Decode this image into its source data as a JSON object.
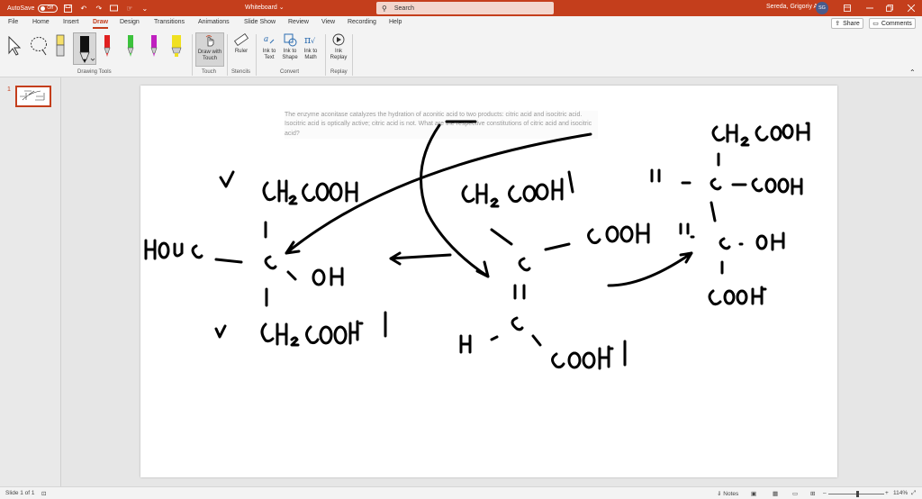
{
  "titlebar": {
    "autosave_label": "AutoSave",
    "autosave_state": "Off",
    "doc_title": "Whiteboard",
    "doc_title_caret": "⌄",
    "search_placeholder": "Search",
    "user_name": "Sereda, Grigoriy A",
    "user_initials": "SG"
  },
  "menu": {
    "tabs": [
      "File",
      "Home",
      "Insert",
      "Draw",
      "Design",
      "Transitions",
      "Animations",
      "Slide Show",
      "Review",
      "View",
      "Recording",
      "Help"
    ],
    "active_tab": "Draw",
    "share_label": "Share",
    "comments_label": "Comments"
  },
  "ribbon": {
    "groups": {
      "drawing_tools": "Drawing Tools",
      "touch": "Touch",
      "stencils": "Stencils",
      "convert": "Convert",
      "replay": "Replay"
    },
    "buttons": {
      "draw_with_touch": "Draw with Touch",
      "ruler": "Ruler",
      "ink_to_text": "Ink to Text",
      "ink_to_shape": "Ink to Shape",
      "ink_to_math": "Ink to Math",
      "ink_replay": "Ink Replay"
    },
    "pen_colors": [
      "#000000",
      "#e02020",
      "#3cc23c",
      "#c020c0",
      "#f0e020"
    ]
  },
  "thumbnail": {
    "slide_number": "1"
  },
  "slide": {
    "question": "The enzyme aconitase catalyzes the hydration of aconitic acid to two products: citric acid and isocitric acid. Isocitric acid is optically active; citric acid is not. What are the respective constitutions of citric acid and isocitric acid?",
    "ink_color": "#000000"
  },
  "status": {
    "slide_info": "Slide 1 of 1",
    "notes_label": "Notes",
    "zoom": "114%"
  }
}
